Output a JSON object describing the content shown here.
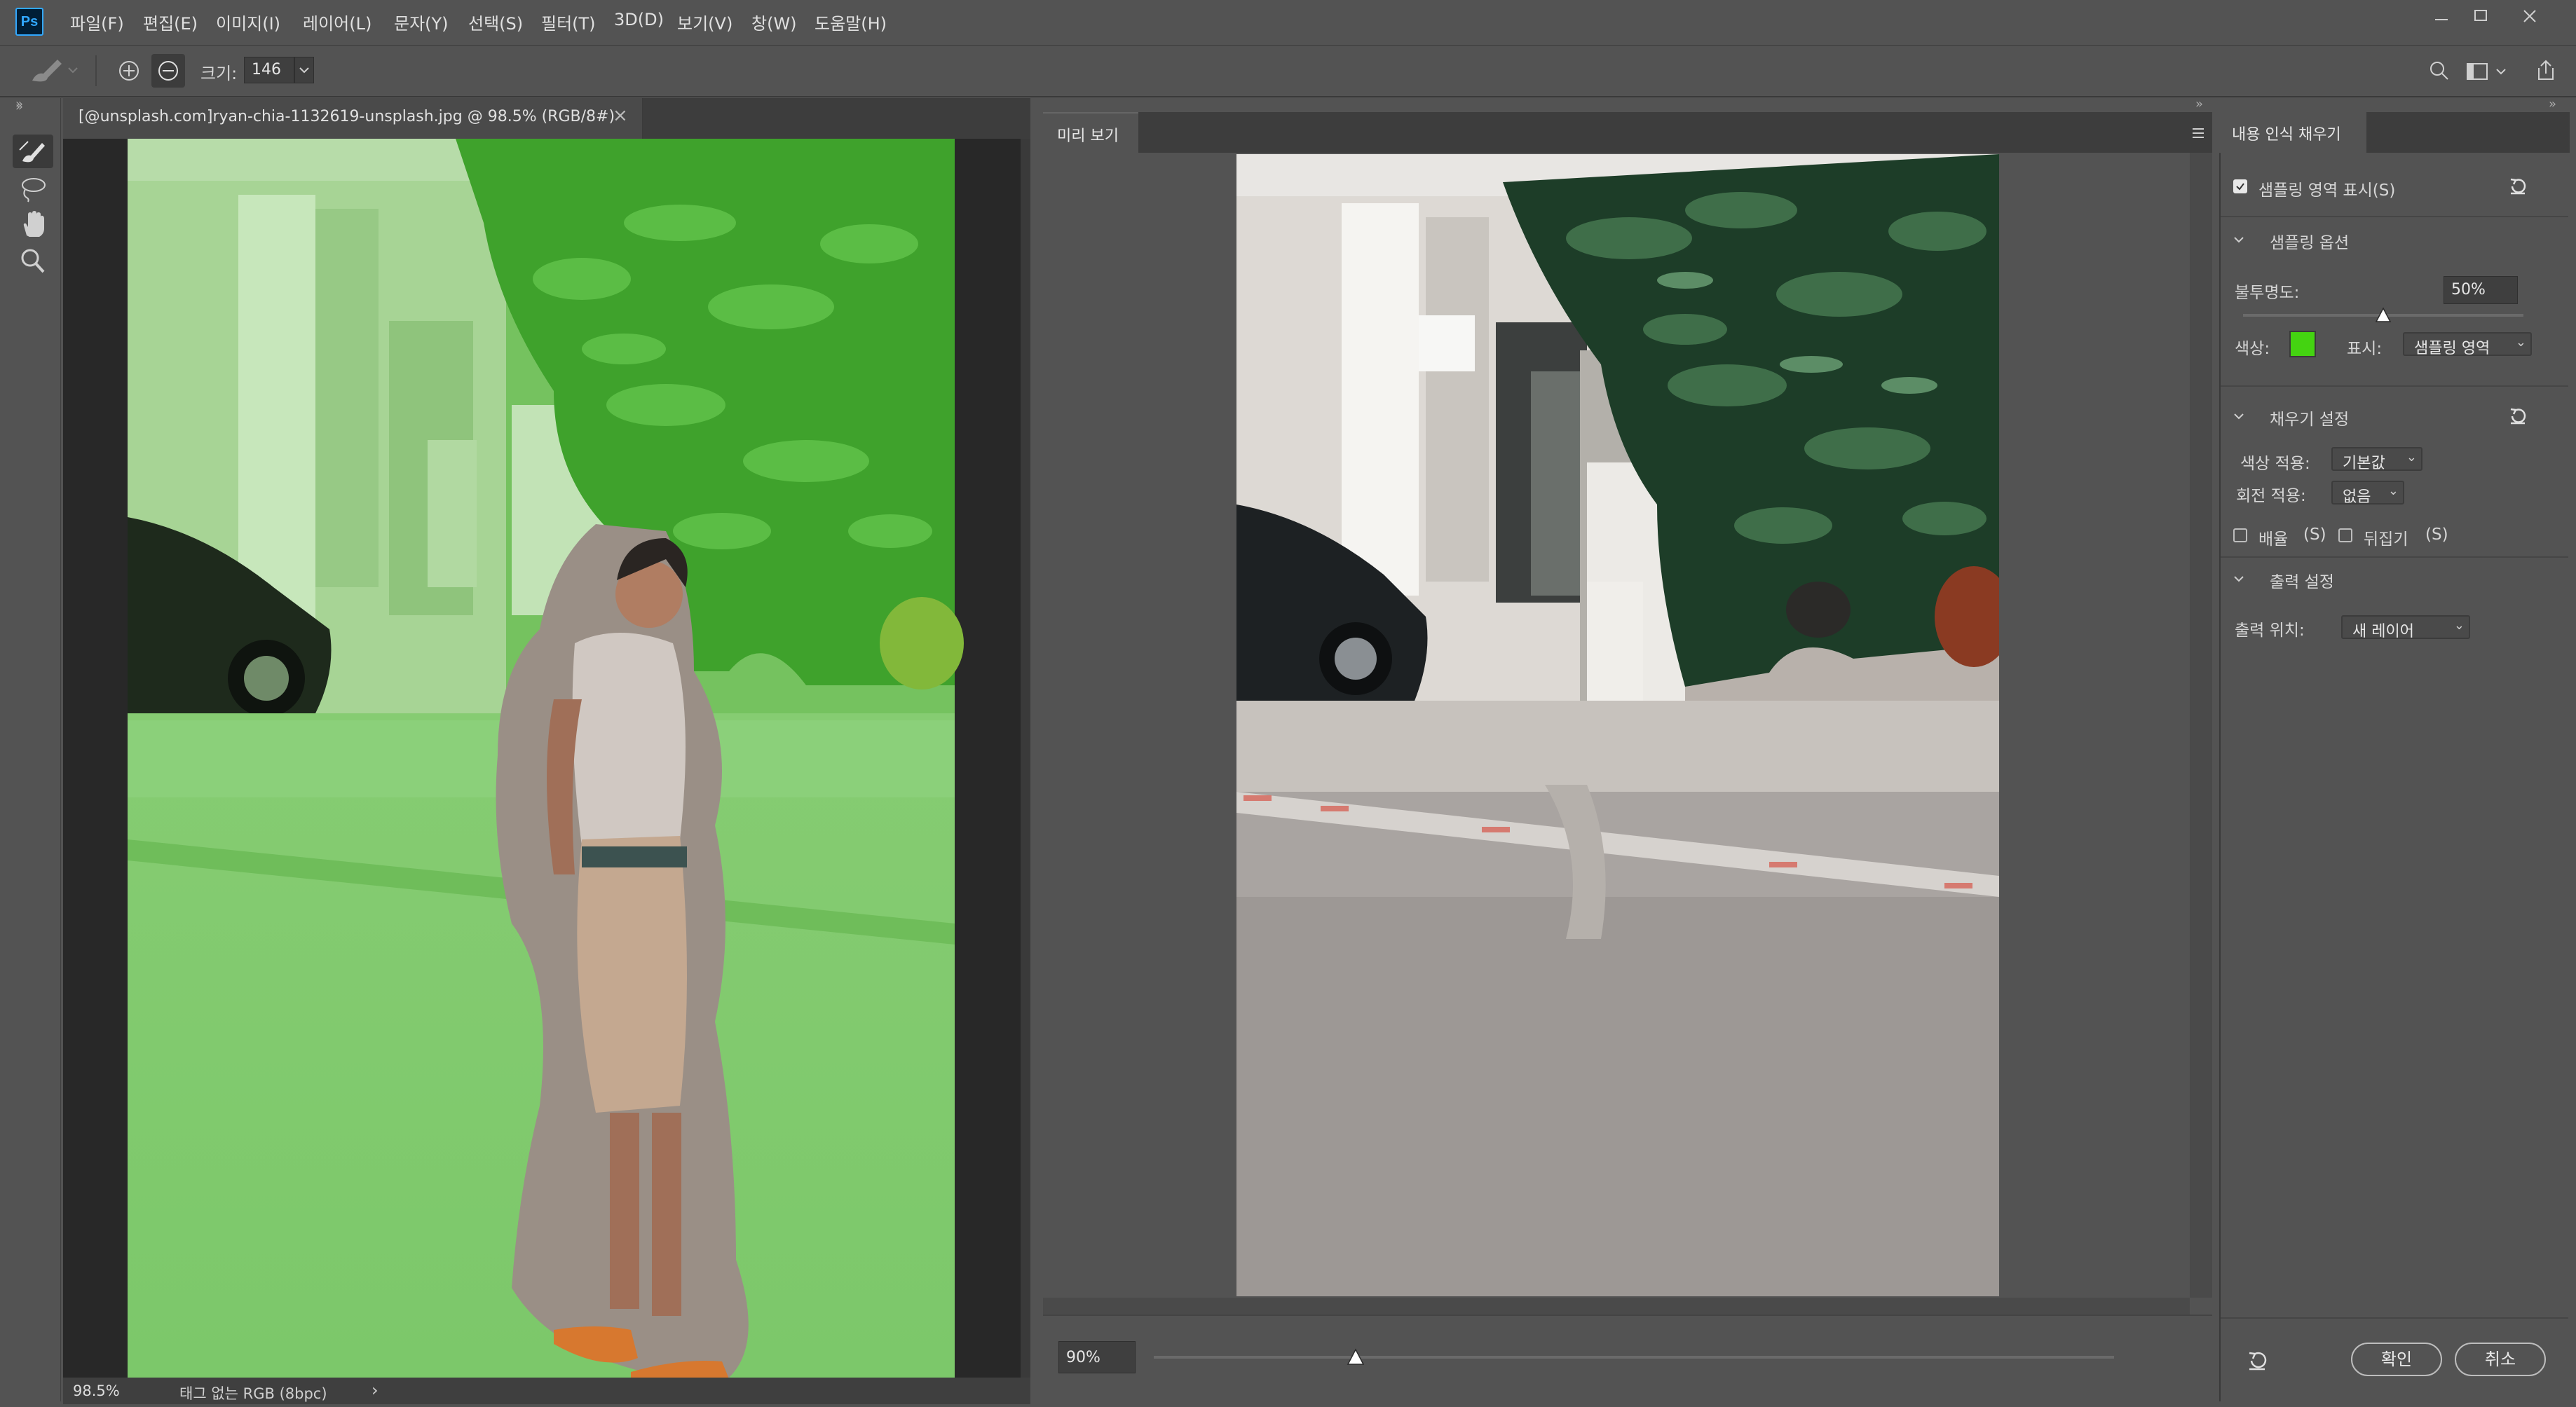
{
  "app": {
    "logo": "Ps"
  },
  "menu": {
    "items": [
      "파일(F)",
      "편집(E)",
      "이미지(I)",
      "레이어(L)",
      "문자(Y)",
      "선택(S)",
      "필터(T)",
      "3D(D)",
      "보기(V)",
      "창(W)",
      "도움말(H)"
    ]
  },
  "options": {
    "size_label": "크기:",
    "size_value": "146"
  },
  "document": {
    "tab_title": "[@unsplash.com]ryan-chia-1132619-unsplash.jpg @ 98.5% (RGB/8#)",
    "close_glyph": "×",
    "zoom": "98.5%",
    "status": "태그 없는 RGB (8bpc)",
    "status_arrow": "›"
  },
  "preview": {
    "tab_label": "미리 보기",
    "zoom_value": "90%",
    "zoom_slider_level": 0.21
  },
  "content_aware_fill": {
    "tab_label": "내용 인식 채우기",
    "show_sampling_label": "샘플링 영역 표시(S)",
    "show_sampling_checked": true,
    "sampling_options": {
      "title": "샘플링 옵션",
      "opacity_label": "불투명도:",
      "opacity_value": "50%",
      "opacity_level": 0.5,
      "color_label": "색상:",
      "color": "#44d311",
      "indicates_label": "표시:",
      "indicates_value": "샘플링 영역"
    },
    "fill_settings": {
      "title": "채우기 설정",
      "color_adaptation_label": "색상 적용:",
      "color_adaptation_value": "기본값",
      "rotation_adaptation_label": "회전 적용:",
      "rotation_adaptation_value": "없음",
      "scale_label": "배율",
      "scale_shortcut": "(S)",
      "mirror_label": "뒤집기",
      "mirror_shortcut": "(S)"
    },
    "output_settings": {
      "title": "출력 설정",
      "output_to_label": "출력 위치:",
      "output_to_value": "새 레이어"
    },
    "ok_label": "확인",
    "cancel_label": "취소"
  },
  "colors": {
    "sampling_overlay": "#44d311",
    "panel": "#535353",
    "dark_panel": "#3d3d3d"
  },
  "icons": [
    "ps-logo-icon",
    "minimize-icon",
    "maximize-icon",
    "close-icon",
    "brush-tool-icon",
    "add-brush-icon",
    "subtract-brush-icon",
    "lasso-icon",
    "hand-icon",
    "zoom-icon",
    "search-icon",
    "workspace-icon",
    "share-icon",
    "panel-menu-icon",
    "reset-icon",
    "chevron-down-icon"
  ]
}
